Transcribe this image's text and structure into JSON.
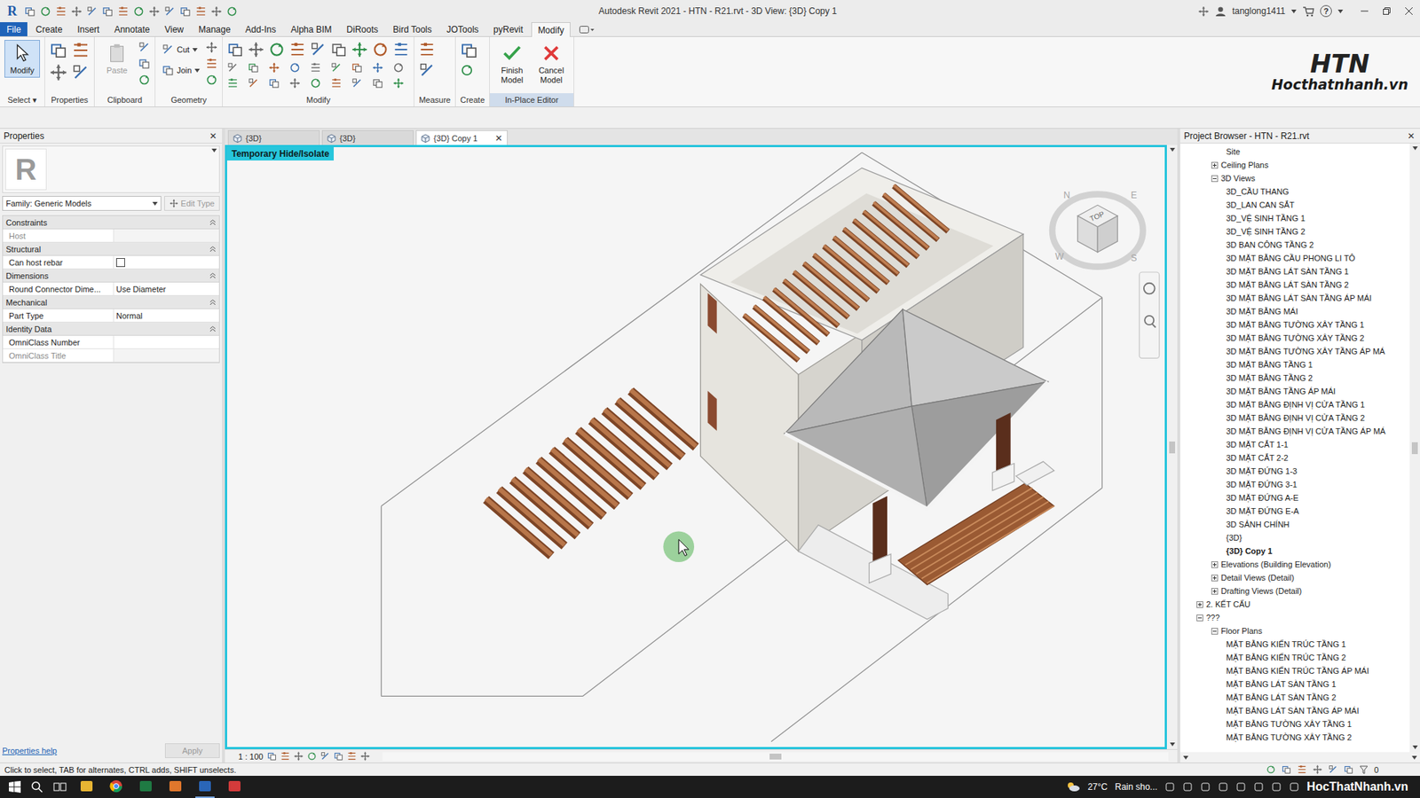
{
  "window": {
    "app_logo": "R",
    "title": "Autodesk Revit 2021 - HTN - R21.rvt - 3D View: {3D} Copy 1",
    "user": "tanglong1411",
    "help": "?"
  },
  "ribbon_tabs": [
    {
      "label": "File",
      "selected": false,
      "kind": "file"
    },
    {
      "label": "Create",
      "selected": false,
      "kind": "tab"
    },
    {
      "label": "Insert",
      "selected": false,
      "kind": "tab"
    },
    {
      "label": "Annotate",
      "selected": false,
      "kind": "tab"
    },
    {
      "label": "View",
      "selected": false,
      "kind": "tab"
    },
    {
      "label": "Manage",
      "selected": false,
      "kind": "tab"
    },
    {
      "label": "Add-Ins",
      "selected": false,
      "kind": "tab"
    },
    {
      "label": "Alpha BIM",
      "selected": false,
      "kind": "tab"
    },
    {
      "label": "DiRoots",
      "selected": false,
      "kind": "tab"
    },
    {
      "label": "Bird Tools",
      "selected": false,
      "kind": "tab"
    },
    {
      "label": "JOTools",
      "selected": false,
      "kind": "tab"
    },
    {
      "label": "pyRevit",
      "selected": false,
      "kind": "tab"
    },
    {
      "label": "Modify",
      "selected": true,
      "kind": "tab"
    }
  ],
  "ribbon_panels": [
    {
      "kind": "select",
      "title": "Select",
      "arrow": "▾",
      "highlight": false,
      "buttons": [
        {
          "label": "Modify",
          "kind": "select",
          "selected": true,
          "disabled": false
        }
      ]
    },
    {
      "kind": "properties",
      "title": "Properties",
      "arrow": "",
      "highlight": false,
      "buttons": []
    },
    {
      "kind": "clipboard",
      "title": "Clipboard",
      "arrow": "",
      "highlight": false,
      "buttons": [
        {
          "label": "Paste",
          "kind": "paste",
          "selected": false,
          "disabled": true
        }
      ]
    },
    {
      "kind": "geometry",
      "title": "Geometry",
      "arrow": "",
      "highlight": false,
      "buttons": [
        {
          "label": "Cut",
          "kind": "cut",
          "selected": false,
          "disabled": false
        },
        {
          "label": "Join",
          "kind": "join",
          "selected": false,
          "disabled": false
        }
      ]
    },
    {
      "kind": "modify",
      "title": "Modify",
      "arrow": "",
      "highlight": false,
      "buttons": []
    },
    {
      "kind": "measure",
      "title": "Measure",
      "arrow": "",
      "highlight": false,
      "buttons": []
    },
    {
      "kind": "create",
      "title": "Create",
      "arrow": "",
      "highlight": false,
      "buttons": []
    },
    {
      "kind": "editor",
      "title": "In-Place Editor",
      "arrow": "",
      "highlight": true,
      "buttons": [
        {
          "label": "Finish Model",
          "kind": "finish",
          "selected": false,
          "disabled": false
        },
        {
          "label": "Cancel Model",
          "kind": "cancel",
          "selected": false,
          "disabled": false
        }
      ]
    }
  ],
  "logo": {
    "mark": "HTN",
    "site": "Hocthatnhanh.vn"
  },
  "properties": {
    "title": "Properties",
    "close": "✕",
    "type_icon": "R",
    "type_selector": "Family: Generic Models",
    "edit_type": "Edit Type",
    "help": "Properties help",
    "apply": "Apply",
    "groups": [
      {
        "name": "Constraints",
        "rows": [
          {
            "label": "Host",
            "value": "",
            "kind": "text",
            "disabled": true
          }
        ]
      },
      {
        "name": "Structural",
        "rows": [
          {
            "label": "Can host rebar",
            "value": "",
            "kind": "checkbox",
            "disabled": false,
            "checked": false
          }
        ]
      },
      {
        "name": "Dimensions",
        "rows": [
          {
            "label": "Round Connector Dime...",
            "value": "Use Diameter",
            "kind": "text",
            "disabled": false
          }
        ]
      },
      {
        "name": "Mechanical",
        "rows": [
          {
            "label": "Part Type",
            "value": "Normal",
            "kind": "text",
            "disabled": false
          }
        ]
      },
      {
        "name": "Identity Data",
        "rows": [
          {
            "label": "OmniClass Number",
            "value": "",
            "kind": "text",
            "disabled": false
          },
          {
            "label": "OmniClass Title",
            "value": "",
            "kind": "text",
            "disabled": true
          }
        ]
      }
    ]
  },
  "view_tabs": [
    {
      "label": "{3D}",
      "selected": false,
      "close": ""
    },
    {
      "label": "{3D}",
      "selected": false,
      "close": ""
    },
    {
      "label": "{3D} Copy 1",
      "selected": true,
      "close": "✕"
    }
  ],
  "view": {
    "mode_label": "Temporary Hide/Isolate",
    "scale": "1 : 100",
    "viewcube": {
      "top": "TOP",
      "compass": [
        "N",
        "E",
        "S",
        "W"
      ]
    }
  },
  "browser": {
    "title": "Project Browser - HTN - R21.rvt",
    "close": "✕",
    "items": [
      {
        "label": "Site",
        "level": 2,
        "kind": "leaf",
        "expanded": false,
        "selected": false
      },
      {
        "label": "Ceiling Plans",
        "level": 1,
        "kind": "folder",
        "expanded": false,
        "selected": false
      },
      {
        "label": "3D Views",
        "level": 1,
        "kind": "folder",
        "expanded": true,
        "selected": false
      },
      {
        "label": "3D_CẦU THANG",
        "level": 2,
        "kind": "leaf",
        "expanded": false,
        "selected": false
      },
      {
        "label": "3D_LAN CAN SẮT",
        "level": 2,
        "kind": "leaf",
        "expanded": false,
        "selected": false
      },
      {
        "label": "3D_VỆ SINH TẦNG 1",
        "level": 2,
        "kind": "leaf",
        "expanded": false,
        "selected": false
      },
      {
        "label": "3D_VỆ SINH TẦNG 2",
        "level": 2,
        "kind": "leaf",
        "expanded": false,
        "selected": false
      },
      {
        "label": "3D BAN CÔNG TẦNG 2",
        "level": 2,
        "kind": "leaf",
        "expanded": false,
        "selected": false
      },
      {
        "label": "3D MẶT BẰNG CẦU PHONG LI TÔ",
        "level": 2,
        "kind": "leaf",
        "expanded": false,
        "selected": false
      },
      {
        "label": "3D MẶT BẰNG LÁT SÀN TẦNG 1",
        "level": 2,
        "kind": "leaf",
        "expanded": false,
        "selected": false
      },
      {
        "label": "3D MẶT BẰNG LÁT SÀN TẦNG 2",
        "level": 2,
        "kind": "leaf",
        "expanded": false,
        "selected": false
      },
      {
        "label": "3D MẶT BẰNG LÁT SÀN TẦNG ÁP MÁI",
        "level": 2,
        "kind": "leaf",
        "expanded": false,
        "selected": false
      },
      {
        "label": "3D MẶT BẰNG MÁI",
        "level": 2,
        "kind": "leaf",
        "expanded": false,
        "selected": false
      },
      {
        "label": "3D MẶT BẰNG TƯỜNG XÂY TẦNG 1",
        "level": 2,
        "kind": "leaf",
        "expanded": false,
        "selected": false
      },
      {
        "label": "3D MẶT BẰNG TƯỜNG XÂY TẦNG 2",
        "level": 2,
        "kind": "leaf",
        "expanded": false,
        "selected": false
      },
      {
        "label": "3D MẶT BẰNG TƯỜNG XÂY TẦNG ÁP MÁ",
        "level": 2,
        "kind": "leaf",
        "expanded": false,
        "selected": false
      },
      {
        "label": "3D MẶT BẰNG TẦNG 1",
        "level": 2,
        "kind": "leaf",
        "expanded": false,
        "selected": false
      },
      {
        "label": "3D MẶT BẰNG TẦNG 2",
        "level": 2,
        "kind": "leaf",
        "expanded": false,
        "selected": false
      },
      {
        "label": "3D MẶT BẰNG TẦNG ÁP MÁI",
        "level": 2,
        "kind": "leaf",
        "expanded": false,
        "selected": false
      },
      {
        "label": "3D MẶT BẰNG ĐỊNH VỊ CỬA TẦNG 1",
        "level": 2,
        "kind": "leaf",
        "expanded": false,
        "selected": false
      },
      {
        "label": "3D MẶT BẰNG ĐỊNH VỊ CỬA TẦNG 2",
        "level": 2,
        "kind": "leaf",
        "expanded": false,
        "selected": false
      },
      {
        "label": "3D MẶT BẰNG ĐỊNH VỊ CỬA TẦNG ÁP MÁ",
        "level": 2,
        "kind": "leaf",
        "expanded": false,
        "selected": false
      },
      {
        "label": "3D MẶT CẮT 1-1",
        "level": 2,
        "kind": "leaf",
        "expanded": false,
        "selected": false
      },
      {
        "label": "3D MẶT CẮT 2-2",
        "level": 2,
        "kind": "leaf",
        "expanded": false,
        "selected": false
      },
      {
        "label": "3D MẶT ĐỨNG 1-3",
        "level": 2,
        "kind": "leaf",
        "expanded": false,
        "selected": false
      },
      {
        "label": "3D MẶT ĐỨNG 3-1",
        "level": 2,
        "kind": "leaf",
        "expanded": false,
        "selected": false
      },
      {
        "label": "3D MẶT ĐỨNG A-E",
        "level": 2,
        "kind": "leaf",
        "expanded": false,
        "selected": false
      },
      {
        "label": "3D MẶT ĐỨNG E-A",
        "level": 2,
        "kind": "leaf",
        "expanded": false,
        "selected": false
      },
      {
        "label": "3D SẢNH CHÍNH",
        "level": 2,
        "kind": "leaf",
        "expanded": false,
        "selected": false
      },
      {
        "label": "{3D}",
        "level": 2,
        "kind": "leaf",
        "expanded": false,
        "selected": false
      },
      {
        "label": "{3D} Copy 1",
        "level": 2,
        "kind": "leaf",
        "expanded": false,
        "selected": true
      },
      {
        "label": "Elevations (Building Elevation)",
        "level": 1,
        "kind": "folder",
        "expanded": false,
        "selected": false
      },
      {
        "label": "Detail Views (Detail)",
        "level": 1,
        "kind": "folder",
        "expanded": false,
        "selected": false
      },
      {
        "label": "Drafting Views (Detail)",
        "level": 1,
        "kind": "folder",
        "expanded": false,
        "selected": false
      },
      {
        "label": "2. KẾT CẤU",
        "level": 0,
        "kind": "folder",
        "expanded": false,
        "selected": false
      },
      {
        "label": "???",
        "level": 0,
        "kind": "folder",
        "expanded": true,
        "selected": false
      },
      {
        "label": "Floor Plans",
        "level": 1,
        "kind": "folder",
        "expanded": true,
        "selected": false
      },
      {
        "label": "MẶT BẰNG KIẾN TRÚC TẦNG 1",
        "level": 2,
        "kind": "leaf",
        "expanded": false,
        "selected": false
      },
      {
        "label": "MẶT BẰNG KIẾN TRÚC TẦNG 2",
        "level": 2,
        "kind": "leaf",
        "expanded": false,
        "selected": false
      },
      {
        "label": "MẶT BẰNG KIẾN TRÚC TẦNG ÁP MÁI",
        "level": 2,
        "kind": "leaf",
        "expanded": false,
        "selected": false
      },
      {
        "label": "MẶT BẰNG LÁT SÀN TẦNG 1",
        "level": 2,
        "kind": "leaf",
        "expanded": false,
        "selected": false
      },
      {
        "label": "MẶT BẰNG LÁT SÀN TẦNG 2",
        "level": 2,
        "kind": "leaf",
        "expanded": false,
        "selected": false
      },
      {
        "label": "MẶT BẰNG LÁT SÀN TẦNG ÁP MÁI",
        "level": 2,
        "kind": "leaf",
        "expanded": false,
        "selected": false
      },
      {
        "label": "MẶT BẰNG TƯỜNG XÂY TẦNG 1",
        "level": 2,
        "kind": "leaf",
        "expanded": false,
        "selected": false
      },
      {
        "label": "MẶT BẰNG TƯỜNG XÂY TẦNG 2",
        "level": 2,
        "kind": "leaf",
        "expanded": false,
        "selected": false
      }
    ]
  },
  "status_bar": {
    "message": "Click to select, TAB for alternates, CTRL adds, SHIFT unselects.",
    "filter_count": "0"
  },
  "taskbar": {
    "temperature": "27°C",
    "weather": "Rain sho...",
    "watermark": "HocThatNhanh.vn"
  }
}
